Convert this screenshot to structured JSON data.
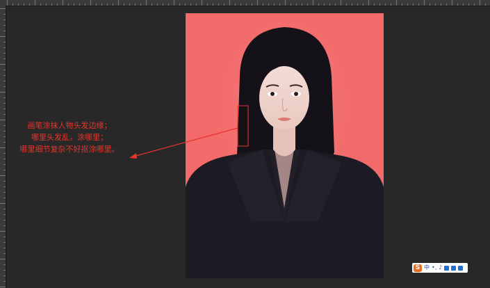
{
  "annotation": {
    "lines": [
      "画笔涂抹人物头发边缘；",
      "哪里头发乱，涂哪里；",
      "哪里细节复杂不好抠涂哪里。"
    ],
    "color": "#e8332b"
  },
  "photo": {
    "background_color": "#f26a6a",
    "subject": "portrait-woman-black-suit"
  },
  "selection_marker_color": "#e8332b",
  "ime_toolbar": {
    "logo": "S",
    "mode": "中",
    "icons": [
      "punctuation-icon",
      "microphone-icon",
      "keyboard-icon",
      "skin-icon",
      "toolbox-icon"
    ]
  }
}
